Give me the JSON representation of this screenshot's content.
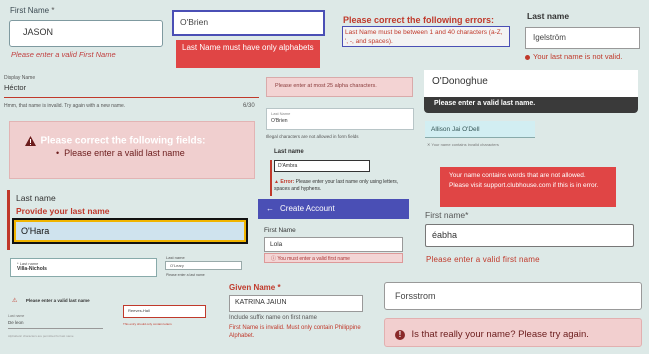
{
  "f1": {
    "label": "First Name",
    "required": "*",
    "value": "JASON",
    "help": "Please enter a valid First Name"
  },
  "f2": {
    "value": "O'Brien",
    "error": "Last Name must have only alphabets"
  },
  "f3": {
    "title": "Please correct the following errors:",
    "message": "Last Name must be between 1 and 40 characters (a-Z, ', -, and spaces)."
  },
  "f4": {
    "label": "Last name",
    "value": "Igelström",
    "error": "Your last name is not valid."
  },
  "f5": {
    "label": "Display Name",
    "value": "Héctor",
    "help": "Hmm, that name is invalid. Try again with a new name.",
    "counter": "6/30"
  },
  "f6": {
    "error": "Please enter at most 25 alpha characters."
  },
  "f7": {
    "value": "O'Donoghue",
    "error": "Please enter a valid last name."
  },
  "f8": {
    "title": "Please correct the following fields:",
    "item": "Please enter a valid last name"
  },
  "f9": {
    "label": "Last Name",
    "value": "O'Brien",
    "error": "Illegal characters are not allowed in form fields"
  },
  "f10": {
    "value": "Allison Jai O'Dell",
    "error": "Your name contains invalid characters"
  },
  "f11": {
    "label": "Last name",
    "value": "D'Ambra",
    "error_prefix": "Error:",
    "error": "Please enter your last name only using letters, spaces and hyphens."
  },
  "f12": {
    "message": "Your name contains words that are not allowed. Please visit support.clubhouse.com if this is in error."
  },
  "f13": {
    "label": "Last name",
    "error": "Provide your last name",
    "value": "O'Hara"
  },
  "f14": {
    "label": "Create Account",
    "arrow": "←"
  },
  "f15": {
    "label": "First Name",
    "value": "Lola",
    "error": "You must enter a valid first name"
  },
  "f16": {
    "label": "First name",
    "required": "*",
    "value": "éabha",
    "error": "Please enter a valid first name"
  },
  "f17": {
    "label": "Last name",
    "required": "*",
    "value": "Villa-Nichols"
  },
  "f18": {
    "label": "Last name",
    "value": "O'Leary",
    "error": "Please enter a last name"
  },
  "f19": {
    "error": "Please enter a valid last name"
  },
  "f20": {
    "label": "Last name",
    "value": "De leon",
    "error": "Alphabetic characters are permitted for last name"
  },
  "f21": {
    "value": "Reeves-Hall",
    "error": "This entry should only contain letters"
  },
  "f22": {
    "label": "Given Name",
    "required": "*",
    "value": "KATRINA JAIUN",
    "help": "Include suffix name on first name",
    "error": "First Name is invalid. Must only contain Philippine Alphabet."
  },
  "f23": {
    "value": "Forsstrom"
  },
  "f24": {
    "message": "Is that really your name? Please try again."
  },
  "icons": {
    "warning": "warning-icon",
    "info": "info-icon",
    "error": "error-icon",
    "arrow": "arrow-left-icon"
  },
  "colors": {
    "background": "#dde9e7",
    "error": "#c0392b",
    "accent_blue": "#4a4fb5",
    "alert_red": "#e04545"
  }
}
